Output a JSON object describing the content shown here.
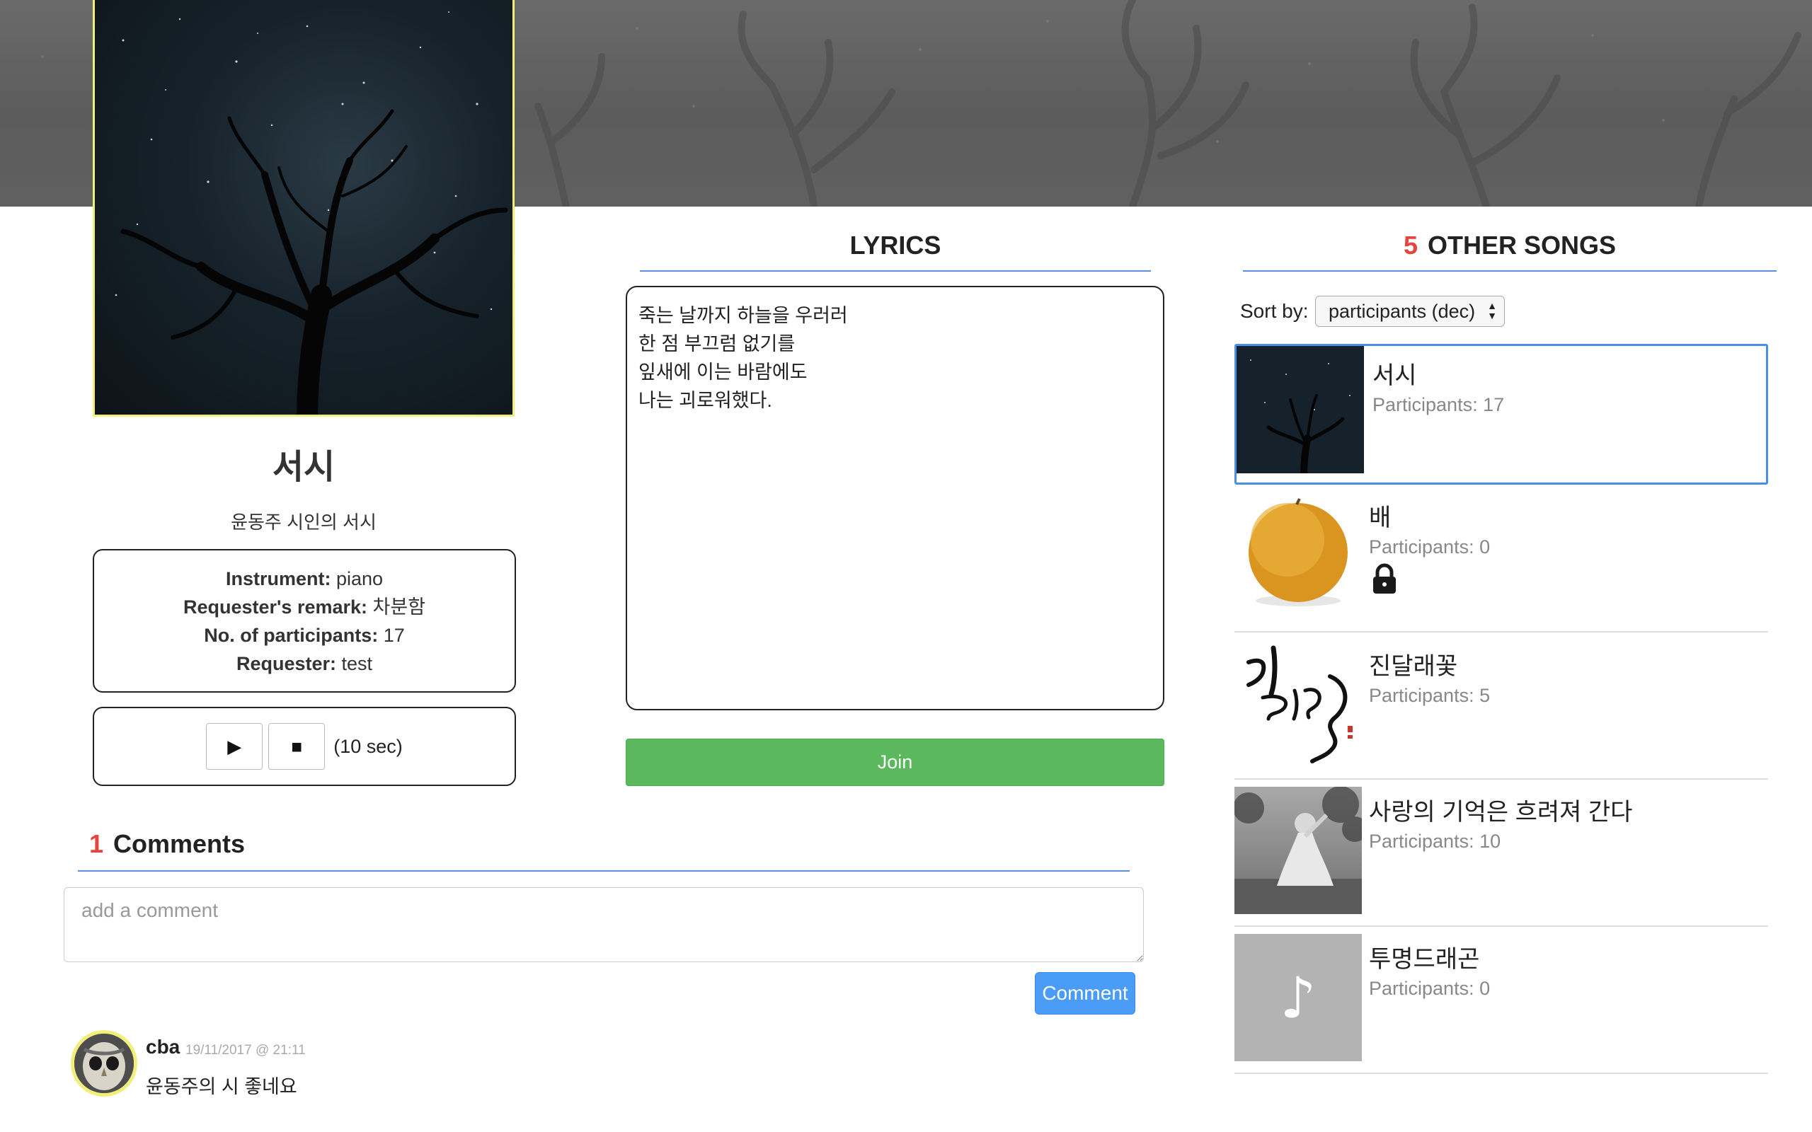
{
  "song": {
    "title": "서시",
    "subtitle": "윤동주 시인의 서시",
    "info": [
      {
        "label": "Instrument:",
        "value": "piano"
      },
      {
        "label": "Requester's remark:",
        "value": "차분함"
      },
      {
        "label": "No. of participants:",
        "value": "17"
      },
      {
        "label": "Requester:",
        "value": "test"
      }
    ],
    "player": {
      "play_icon": "▶",
      "stop_icon": "■",
      "duration": "(10 sec)"
    }
  },
  "lyrics": {
    "heading": "LYRICS",
    "text": "죽는 날까지 하늘을 우러러\n한 점 부끄럼 없기를\n잎새에 이는 바람에도\n나는 괴로워했다.",
    "join_label": "Join"
  },
  "comments": {
    "count": "1",
    "heading": "Comments",
    "placeholder": "add a comment",
    "button_label": "Comment",
    "items": [
      {
        "user": "cba",
        "date": "19/11/2017 @ 21:11",
        "text": "윤동주의 시 좋네요"
      }
    ]
  },
  "other_songs": {
    "count": "5",
    "heading": "OTHER SONGS",
    "sort_label": "Sort by:",
    "sort_value": "participants (dec)",
    "items": [
      {
        "title": "서시",
        "participants": "Participants: 17",
        "locked": false,
        "thumb": "night-sky"
      },
      {
        "title": "배",
        "participants": "Participants: 0",
        "locked": true,
        "thumb": "pear"
      },
      {
        "title": "진달래꽃",
        "participants": "Participants: 5",
        "locked": false,
        "thumb": "calligraphy"
      },
      {
        "title": "사랑의 기억은 흐려져 간다",
        "participants": "Participants: 10",
        "locked": false,
        "thumb": "photo"
      },
      {
        "title": "투명드래곤",
        "participants": "Participants: 0",
        "locked": false,
        "thumb": "music-note",
        "note_glyph": "♪"
      }
    ]
  },
  "colors": {
    "accent_blue": "#4a90e2",
    "count_red": "#e5453d",
    "join_green": "#5cb85c",
    "highlight_yellow": "#f2ee7a"
  }
}
